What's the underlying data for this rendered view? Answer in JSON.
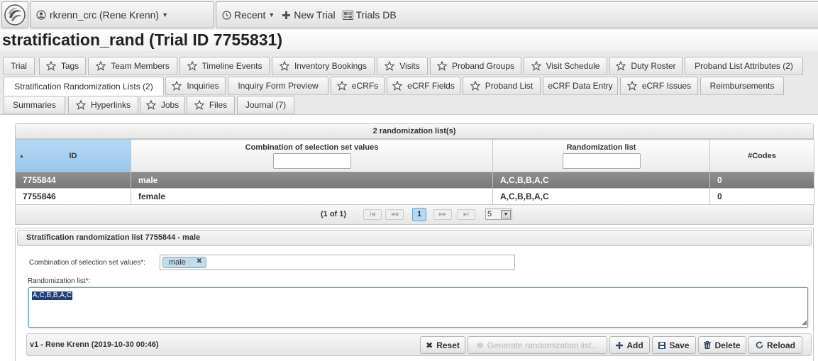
{
  "topbar": {
    "user_label": "rkrenn_crc (Rene Krenn)",
    "menu": [
      {
        "label": "Recent",
        "icon": "history-icon"
      },
      {
        "label": "New Trial",
        "icon": "plus-icon"
      },
      {
        "label": "Trials DB",
        "icon": "database-icon"
      }
    ]
  },
  "page": {
    "title": "stratification_rand (Trial ID 7755831)"
  },
  "tabs": [
    {
      "label": "Trial",
      "star": false
    },
    {
      "label": "Tags",
      "star": true
    },
    {
      "label": "Team Members",
      "star": true
    },
    {
      "label": "Timeline Events",
      "star": true
    },
    {
      "label": "Inventory Bookings",
      "star": true
    },
    {
      "label": "Visits",
      "star": true
    },
    {
      "label": "Proband Groups",
      "star": true
    },
    {
      "label": "Visit Schedule",
      "star": true
    },
    {
      "label": "Duty Roster",
      "star": true
    },
    {
      "label": "Proband List Attributes (2)",
      "star": false
    },
    {
      "label": "Stratification Randomization Lists (2)",
      "star": false,
      "active": true
    },
    {
      "label": "Inquiries",
      "star": true
    },
    {
      "label": "Inquiry Form Preview",
      "star": false
    },
    {
      "label": "eCRFs",
      "star": true
    },
    {
      "label": "eCRF Fields",
      "star": true
    },
    {
      "label": "Proband List",
      "star": true
    },
    {
      "label": "eCRF Data Entry",
      "star": false
    },
    {
      "label": "eCRF Issues",
      "star": true
    },
    {
      "label": "Reimbursements",
      "star": false
    },
    {
      "label": "Summaries",
      "star": false
    },
    {
      "label": "Hyperlinks",
      "star": true
    },
    {
      "label": "Jobs",
      "star": true
    },
    {
      "label": "Files",
      "star": true
    },
    {
      "label": "Journal (7)",
      "star": false
    }
  ],
  "table": {
    "caption": "2 randomization list(s)",
    "columns": [
      "ID",
      "Combination of selection set values",
      "Randomization list",
      "#Codes"
    ],
    "rows": [
      {
        "id": "7755844",
        "combination": "male",
        "list": "A,C,B,B,A,C",
        "codes": "0"
      },
      {
        "id": "7755846",
        "combination": "female",
        "list": "A,C,B,B,A,C",
        "codes": "0"
      }
    ],
    "paginator": {
      "info": "(1 of 1)",
      "page": "1",
      "rows_per_page": "5"
    }
  },
  "detail": {
    "header": "Stratification randomization list 7755844 - male",
    "combination_label": "Combination of selection set values*:",
    "combination_chip": "male",
    "list_label": "Randomization list*:",
    "list_value": "A,C,B,B,A,C",
    "version": "v1 - Rene Krenn (2019-10-30 00:46)",
    "buttons": {
      "reset": "Reset",
      "generate": "Generate randomization list...",
      "add": "Add",
      "save": "Save",
      "delete": "Delete",
      "reload": "Reload"
    }
  },
  "colors": {
    "selected_row": "#808080",
    "sorted_header": "#a8d0f0",
    "chip": "#c2dcef"
  }
}
